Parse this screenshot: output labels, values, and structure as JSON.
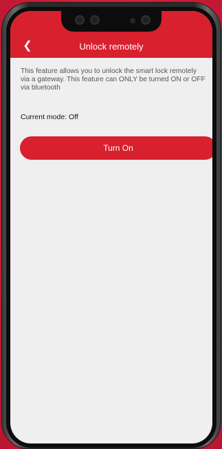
{
  "header": {
    "back_icon": "chevron-left-icon",
    "back_glyph": "❮",
    "title": "Unlock remotely"
  },
  "content": {
    "description": "This feature allows you to unlock the smart lock remotely via a gateway. This feature can ONLY be turned ON or OFF via bluetooth",
    "current_mode": "Current mode: Off",
    "turn_on_label": "Turn On"
  },
  "colors": {
    "accent": "#d8202e",
    "background": "#d01e3a",
    "screen": "#efefef"
  }
}
